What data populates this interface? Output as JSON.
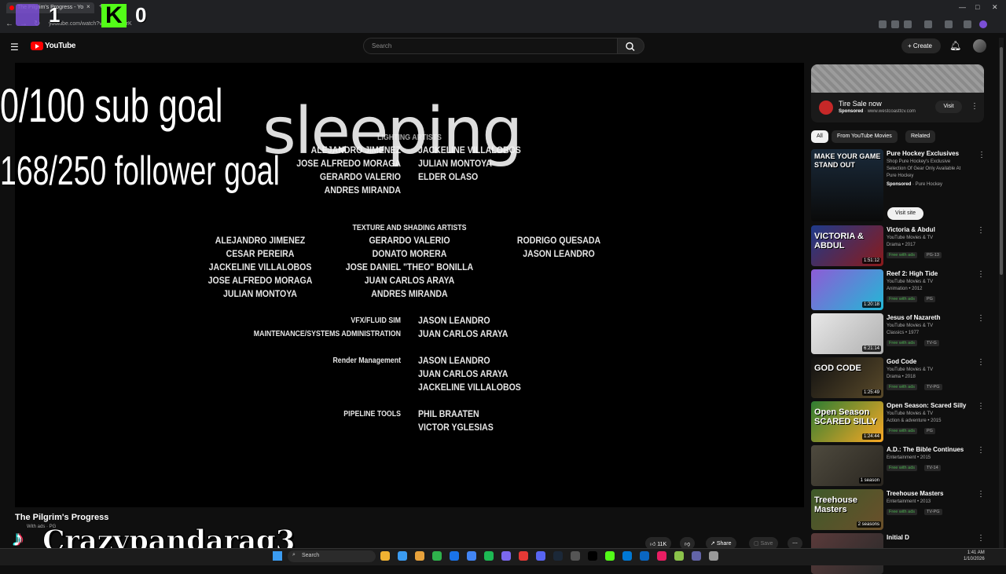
{
  "browser": {
    "tab_title": "The Pilgrim's Progress - Yo",
    "tab_close": "×",
    "new_tab": "+",
    "url": "youtube.com/watch?v=...LCSpsrK",
    "min": "—",
    "max": "□",
    "close": "✕",
    "back": "←",
    "forward": "→",
    "reload": "↻"
  },
  "yt_header": {
    "logo_text": "YouTube",
    "search_placeholder": "Search",
    "create_label": "+ Create"
  },
  "stream_overlay": {
    "twitch_count": "1",
    "kick_count": "0",
    "sub_goal": "0/100 sub goal",
    "follower_goal": "168/250 follower goal",
    "status_text": "sleeping",
    "watermark": "Crazypandarag3"
  },
  "credits": {
    "lighting_head": "LIGHTING ARTISTS",
    "lighting_left": "ALEJANDRO JIMENEZ\nJOSE ALFREDO MORAGA\nGERARDO VALERIO\nANDRES MIRANDA",
    "lighting_right": "JACKELINE VILLALOBOS\nJULIAN MONTOYA\nELDER OLASO",
    "texture_head": "TEXTURE AND SHADING ARTISTS",
    "texture_col1": "ALEJANDRO JIMENEZ\nCESAR PEREIRA\nJACKELINE VILLALOBOS\nJOSE ALFREDO MORAGA\nJULIAN MONTOYA",
    "texture_col2": "GERARDO VALERIO\nDONATO MORERA\nJOSE DANIEL \"THEO\" BONILLA\nJUAN CARLOS ARAYA\nANDRES MIRANDA",
    "texture_col3": "RODRIGO QUESADA\nJASON LEANDRO",
    "vfx_label": "VFX/FLUID SIM",
    "vfx_name": "JASON LEANDRO",
    "maint_label": "MAINTENANCE/SYSTEMS ADMINISTRATION",
    "maint_name": "JUAN CARLOS ARAYA",
    "render_label": "Render Management",
    "render_names": "JASON LEANDRO\nJUAN CARLOS ARAYA\nJACKELINE VILLALOBOS",
    "pipeline_label": "PIPELINE TOOLS",
    "pipeline_names": "PHIL BRAATEN\nVICTOR YGLESIAS"
  },
  "video": {
    "title": "The Pilgrim's Progress",
    "sub_line": "With ads · PG",
    "likes": "11K",
    "share": "Share",
    "save": "Save"
  },
  "ad": {
    "title": "Tire Sale now",
    "sponsored": "Sponsored",
    "domain": "www.westcoasttcv.com",
    "visit": "Visit"
  },
  "chips": [
    "All",
    "From YouTube Movies",
    "Related"
  ],
  "promo": {
    "title": "Pure Hockey Exclusives",
    "desc1": "Shop Pure Hockey's Exclusive",
    "desc2": "Selection Of Gear Only Available At",
    "desc3": "Pure Hockey",
    "sponsored": "Sponsored",
    "brand": "· Pure Hockey",
    "thumb_text": "MAKE YOUR GAME\nSTAND OUT",
    "visit_site": "Visit site"
  },
  "recs": [
    {
      "title": "Victoria & Abdul",
      "channel": "YouTube Movies & TV",
      "genre": "Drama • 2017",
      "badge": "Free with ads",
      "rating": "PG-13",
      "time": "1:51:12",
      "thumb": "VICTORIA & ABDUL",
      "color1": "#1e3a8a",
      "color2": "#8b1a1a"
    },
    {
      "title": "Reef 2: High Tide",
      "channel": "YouTube Movies & TV",
      "genre": "Animation • 2012",
      "badge": "Free with ads",
      "rating": "PG",
      "time": "1:20:18",
      "thumb": "",
      "color1": "#8e5bd6",
      "color2": "#22b8d6"
    },
    {
      "title": "Jesus of Nazareth",
      "channel": "YouTube Movies & TV",
      "genre": "Classics • 1977",
      "badge": "Free with ads",
      "rating": "TV-G",
      "time": "6:21:14",
      "thumb": "",
      "color1": "#e8e8e8",
      "color2": "#b0b0b0"
    },
    {
      "title": "God Code",
      "channel": "YouTube Movies & TV",
      "genre": "Drama • 2018",
      "badge": "Free with ads",
      "rating": "TV-PG",
      "time": "1:25:49",
      "thumb": "GOD CODE",
      "color1": "#111111",
      "color2": "#5a4a2a"
    },
    {
      "title": "Open Season: Scared Silly",
      "channel": "YouTube Movies & TV",
      "genre": "Action & adventure • 2015",
      "badge": "Free with ads",
      "rating": "PG",
      "time": "1:24:44",
      "thumb": "Open Season SCARED SILLY",
      "color1": "#2e7d32",
      "color2": "#f9a825"
    },
    {
      "title": "A.D.: The Bible Continues",
      "channel": "Entertainment • 2015",
      "genre": "",
      "badge": "Free with ads",
      "rating": "TV-14",
      "time": "1 season",
      "thumb": "",
      "color1": "#4e4a3e",
      "color2": "#2a2620"
    },
    {
      "title": "Treehouse Masters",
      "channel": "Entertainment • 2013",
      "genre": "",
      "badge": "Free with ads",
      "rating": "TV-PG",
      "time": "2 seasons",
      "thumb": "Treehouse Masters",
      "color1": "#3e5a2a",
      "color2": "#6b4f2a"
    },
    {
      "title": "Initial D",
      "channel": "",
      "genre": "",
      "badge": "",
      "rating": "",
      "time": "",
      "thumb": "",
      "color1": "#5a3a3a",
      "color2": "#2a2a2a"
    }
  ],
  "taskbar": {
    "search": "Search",
    "time": "1:41 AM",
    "date": "1/10/2026"
  }
}
